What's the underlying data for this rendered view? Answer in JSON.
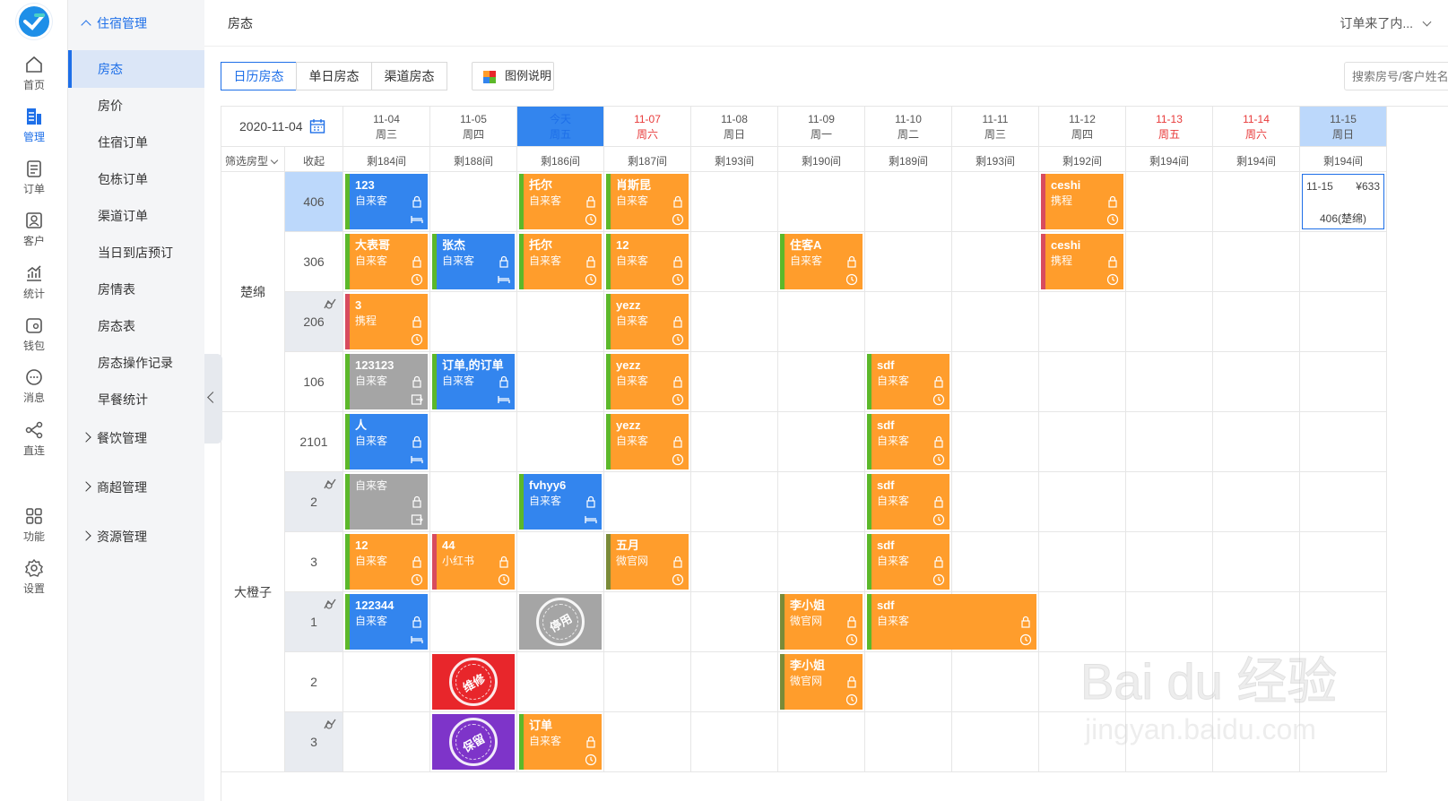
{
  "rail": [
    {
      "label": "首页",
      "icon": "home-icon"
    },
    {
      "label": "管理",
      "icon": "manage-icon",
      "active": true
    },
    {
      "label": "订单",
      "icon": "order-icon"
    },
    {
      "label": "客户",
      "icon": "customer-icon"
    },
    {
      "label": "统计",
      "icon": "stats-icon"
    },
    {
      "label": "钱包",
      "icon": "wallet-icon"
    },
    {
      "label": "消息",
      "icon": "message-icon"
    },
    {
      "label": "直连",
      "icon": "connect-icon"
    },
    {
      "label": "功能",
      "icon": "apps-icon"
    },
    {
      "label": "设置",
      "icon": "settings-icon"
    }
  ],
  "menu": {
    "group_open": "住宿管理",
    "items": [
      "房态",
      "房价",
      "住宿订单",
      "包栋订单",
      "渠道订单",
      "当日到店预订",
      "房情表",
      "房态表",
      "房态操作记录",
      "早餐统计"
    ],
    "active_item": "房态",
    "groups_closed": [
      "餐饮管理",
      "商超管理",
      "资源管理"
    ]
  },
  "topbar": {
    "title": "房态",
    "notice": "订单来了内..."
  },
  "toolbar": {
    "tabs": [
      "日历房态",
      "单日房态",
      "渠道房态"
    ],
    "active_tab": "日历房态",
    "legend": "图例说明",
    "search_placeholder": "搜索房号/客户姓名"
  },
  "calendar": {
    "date": "2020-11-04",
    "filter": "筛选房型",
    "collapse": "收起",
    "days": [
      {
        "date": "11-04",
        "week": "周三",
        "rem": "剩184间"
      },
      {
        "date": "11-05",
        "week": "周四",
        "rem": "剩188间"
      },
      {
        "date": "今天",
        "week": "周五",
        "rem": "剩186间",
        "style": "blue"
      },
      {
        "date": "11-07",
        "week": "周六",
        "rem": "剩187间",
        "style": "red"
      },
      {
        "date": "11-08",
        "week": "周日",
        "rem": "剩193间"
      },
      {
        "date": "11-09",
        "week": "周一",
        "rem": "剩190间"
      },
      {
        "date": "11-10",
        "week": "周二",
        "rem": "剩189间"
      },
      {
        "date": "11-11",
        "week": "周三",
        "rem": "剩193间"
      },
      {
        "date": "11-12",
        "week": "周四",
        "rem": "剩192间"
      },
      {
        "date": "11-13",
        "week": "周五",
        "rem": "剩194间",
        "style": "red"
      },
      {
        "date": "11-14",
        "week": "周六",
        "rem": "剩194间",
        "style": "red"
      },
      {
        "date": "11-15",
        "week": "周日",
        "rem": "剩194间",
        "style": "sel"
      }
    ],
    "room_types": [
      {
        "name": "楚绵",
        "rows": 4
      },
      {
        "name": "大橙子",
        "rows": 6
      }
    ],
    "rooms": [
      {
        "no": "406",
        "sel": true
      },
      {
        "no": "306"
      },
      {
        "no": "206",
        "dirty": true
      },
      {
        "no": "106"
      },
      {
        "no": "2101"
      },
      {
        "no": "2",
        "dirty": true
      },
      {
        "no": "3"
      },
      {
        "no": "1",
        "dirty": true
      },
      {
        "no": "2"
      },
      {
        "no": "3",
        "dirty": true
      }
    ],
    "bookings": [
      {
        "row": 0,
        "col": 0,
        "span": 1,
        "guest": "123",
        "src": "自来客",
        "color": "blue"
      },
      {
        "row": 0,
        "col": 2,
        "span": 1,
        "guest": "托尔",
        "src": "自来客",
        "color": "orange"
      },
      {
        "row": 0,
        "col": 3,
        "span": 1,
        "guest": "肖斯昆",
        "src": "自来客",
        "color": "orange"
      },
      {
        "row": 0,
        "col": 8,
        "span": 1,
        "guest": "ceshi",
        "src": "携程",
        "color": "orange",
        "edge": "red"
      },
      {
        "row": 1,
        "col": 0,
        "span": 1,
        "guest": "大表哥",
        "src": "自来客",
        "color": "orange"
      },
      {
        "row": 1,
        "col": 1,
        "span": 1,
        "guest": "张杰",
        "src": "自来客",
        "color": "blue"
      },
      {
        "row": 1,
        "col": 2,
        "span": 1,
        "guest": "托尔",
        "src": "自来客",
        "color": "orange"
      },
      {
        "row": 1,
        "col": 3,
        "span": 1,
        "guest": "12",
        "src": "自来客",
        "color": "orange"
      },
      {
        "row": 1,
        "col": 5,
        "span": 1,
        "guest": "住客A",
        "src": "自来客",
        "color": "orange"
      },
      {
        "row": 1,
        "col": 8,
        "span": 1,
        "guest": "ceshi",
        "src": "携程",
        "color": "orange",
        "edge": "red"
      },
      {
        "row": 2,
        "col": 0,
        "span": 1,
        "guest": "3",
        "src": "携程",
        "color": "orange",
        "edge": "red"
      },
      {
        "row": 2,
        "col": 3,
        "span": 1,
        "guest": "yezz",
        "src": "自来客",
        "color": "orange"
      },
      {
        "row": 3,
        "col": 0,
        "span": 1,
        "guest": "123123",
        "src": "自来客",
        "color": "gray"
      },
      {
        "row": 3,
        "col": 1,
        "span": 1,
        "guest": "订单,的订单",
        "src": "自来客",
        "color": "blue"
      },
      {
        "row": 3,
        "col": 3,
        "span": 1,
        "guest": "yezz",
        "src": "自来客",
        "color": "orange"
      },
      {
        "row": 3,
        "col": 6,
        "span": 1,
        "guest": "sdf",
        "src": "自来客",
        "color": "orange"
      },
      {
        "row": 4,
        "col": 0,
        "span": 1,
        "guest": "人",
        "src": "自来客",
        "color": "blue"
      },
      {
        "row": 4,
        "col": 3,
        "span": 1,
        "guest": "yezz",
        "src": "自来客",
        "color": "orange"
      },
      {
        "row": 4,
        "col": 6,
        "span": 1,
        "guest": "sdf",
        "src": "自来客",
        "color": "orange"
      },
      {
        "row": 5,
        "col": 0,
        "span": 1,
        "guest": "",
        "src": "自来客",
        "color": "gray"
      },
      {
        "row": 5,
        "col": 2,
        "span": 1,
        "guest": "fvhyy6",
        "src": "自来客",
        "color": "blue"
      },
      {
        "row": 5,
        "col": 6,
        "span": 1,
        "guest": "sdf",
        "src": "自来客",
        "color": "orange"
      },
      {
        "row": 6,
        "col": 0,
        "span": 1,
        "guest": "12",
        "src": "自来客",
        "color": "orange"
      },
      {
        "row": 6,
        "col": 1,
        "span": 1,
        "guest": "44",
        "src": "小红书",
        "color": "orange",
        "edge": "red"
      },
      {
        "row": 6,
        "col": 3,
        "span": 1,
        "guest": "五月",
        "src": "微官网",
        "color": "orange",
        "edge": "dark"
      },
      {
        "row": 6,
        "col": 6,
        "span": 1,
        "guest": "sdf",
        "src": "自来客",
        "color": "orange"
      },
      {
        "row": 7,
        "col": 0,
        "span": 1,
        "guest": "122344",
        "src": "自来客",
        "color": "blue"
      },
      {
        "row": 7,
        "col": 5,
        "span": 1,
        "guest": "李小姐",
        "src": "微官网",
        "color": "orange",
        "edge": "dark"
      },
      {
        "row": 7,
        "col": 6,
        "span": 2,
        "guest": "sdf",
        "src": "自来客",
        "color": "orange"
      },
      {
        "row": 8,
        "col": 5,
        "span": 1,
        "guest": "李小姐",
        "src": "微官网",
        "color": "orange",
        "edge": "dark"
      },
      {
        "row": 9,
        "col": 2,
        "span": 1,
        "guest": "订单",
        "src": "自来客",
        "color": "orange"
      }
    ],
    "stamps": [
      {
        "row": 7,
        "col": 2,
        "label": "停用",
        "color": "gray"
      },
      {
        "row": 8,
        "col": 1,
        "label": "维修",
        "color": "redbg"
      },
      {
        "row": 9,
        "col": 1,
        "label": "保留",
        "color": "purple"
      }
    ],
    "price_box": {
      "row": 0,
      "col": 11,
      "date": "11-15",
      "price": "¥633",
      "room": "406(楚绵)"
    }
  },
  "watermark": {
    "brand": "Bai du 经验",
    "url": "jingyan.baidu.com"
  },
  "colors": {
    "accent": "#1e6fe8",
    "orange": "#ff9d2c",
    "blue": "#3385ee",
    "gray": "#a5a5a5",
    "red": "#e8262b",
    "purple": "#7e34c9"
  }
}
